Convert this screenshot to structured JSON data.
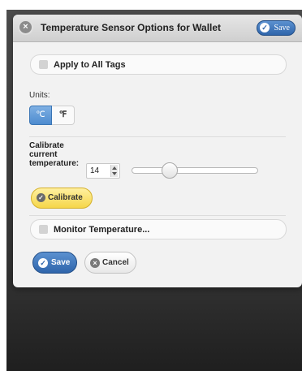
{
  "dialog": {
    "title": "Temperature Sensor Options for Wallet",
    "header_save_label": "Save"
  },
  "apply_all": {
    "label": "Apply to All Tags",
    "checked": false
  },
  "units": {
    "label": "Units:",
    "options": [
      "℃",
      "℉"
    ],
    "selected": "℃"
  },
  "calibrate": {
    "label": "Calibrate current temperature:",
    "value": "14",
    "slider_level": 0.3,
    "button_label": "Calibrate"
  },
  "monitor": {
    "label": "Monitor Temperature...",
    "checked": false
  },
  "footer": {
    "save_label": "Save",
    "cancel_label": "Cancel"
  },
  "colors": {
    "accent_blue": "#2f65ab",
    "calibrate_yellow": "#f5d64a",
    "dialog_bg": "#f2f2f2"
  },
  "icons": {
    "close": "close-icon",
    "check": "check-icon",
    "cancel": "cancel-icon"
  }
}
